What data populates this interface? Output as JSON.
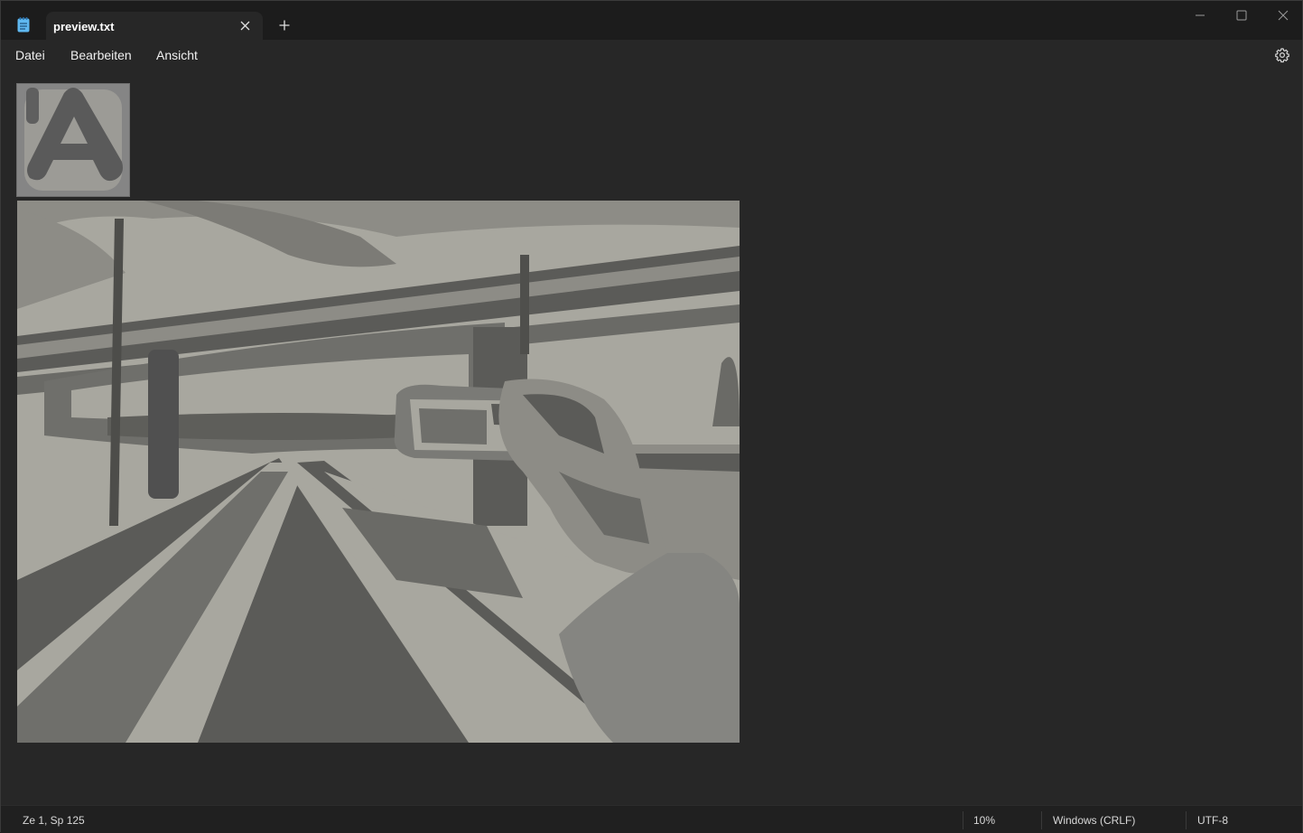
{
  "tab": {
    "title": "preview.txt",
    "close_icon": "close-icon",
    "new_tab_icon": "plus-icon"
  },
  "window_controls": {
    "minimize_icon": "minimize-icon",
    "maximize_icon": "maximize-icon",
    "close_icon": "close-icon"
  },
  "menu": {
    "items": [
      "Datei",
      "Bearbeiten",
      "Ansicht"
    ],
    "settings_icon": "gear-icon"
  },
  "status": {
    "position": "Ze 1, Sp 125",
    "zoom": "10%",
    "line_ending": "Windows (CRLF)",
    "encoding": "UTF-8"
  },
  "colors": {
    "titlebar": "#1c1c1c",
    "editor_bg": "#272727",
    "accent_icon": "#4cc2ff"
  }
}
